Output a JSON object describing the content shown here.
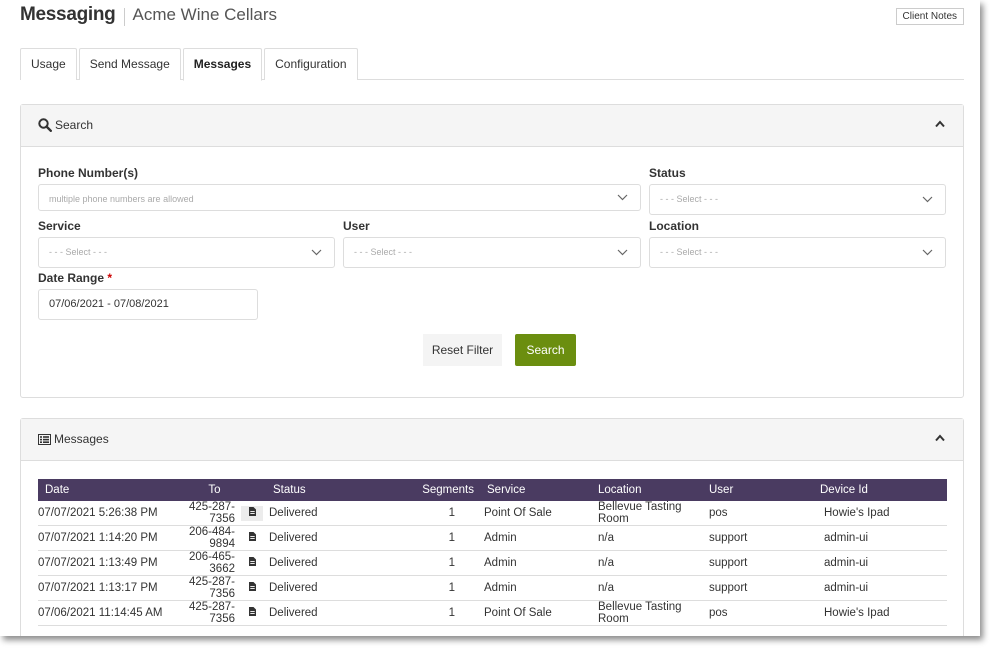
{
  "header": {
    "app_title": "Messaging",
    "client_name": "Acme Wine Cellars",
    "client_notes_label": "Client Notes"
  },
  "tabs": [
    {
      "label": "Usage",
      "active": false
    },
    {
      "label": "Send Message",
      "active": false
    },
    {
      "label": "Messages",
      "active": true
    },
    {
      "label": "Configuration",
      "active": false
    }
  ],
  "search_panel": {
    "title": "Search",
    "phone_numbers": {
      "label": "Phone Number(s)",
      "placeholder": "multiple phone numbers are allowed"
    },
    "status": {
      "label": "Status",
      "placeholder": "- - - Select - - -"
    },
    "service": {
      "label": "Service",
      "placeholder": "- - - Select - - -"
    },
    "user": {
      "label": "User",
      "placeholder": "- - - Select - - -"
    },
    "location": {
      "label": "Location",
      "placeholder": "- - - Select - - -"
    },
    "date_range": {
      "label": "Date Range",
      "required_mark": "*",
      "value": "07/06/2021 - 07/08/2021"
    },
    "reset_label": "Reset Filter",
    "search_label": "Search"
  },
  "messages_panel": {
    "title": "Messages",
    "columns": [
      "Date",
      "To",
      "Status",
      "Segments",
      "Service",
      "Location",
      "User",
      "Device Id"
    ],
    "rows": [
      {
        "date": "07/07/2021 5:26:38 PM",
        "to": "425-287-7356",
        "status": "Delivered",
        "segments": "1",
        "service": "Point Of Sale",
        "location": "Bellevue Tasting Room",
        "user": "pos",
        "device": "Howie's Ipad"
      },
      {
        "date": "07/07/2021 1:14:20 PM",
        "to": "206-484-9894",
        "status": "Delivered",
        "segments": "1",
        "service": "Admin",
        "location": "n/a",
        "user": "support",
        "device": "admin-ui"
      },
      {
        "date": "07/07/2021 1:13:49 PM",
        "to": "206-465-3662",
        "status": "Delivered",
        "segments": "1",
        "service": "Admin",
        "location": "n/a",
        "user": "support",
        "device": "admin-ui"
      },
      {
        "date": "07/07/2021 1:13:17 PM",
        "to": "425-287-7356",
        "status": "Delivered",
        "segments": "1",
        "service": "Admin",
        "location": "n/a",
        "user": "support",
        "device": "admin-ui"
      },
      {
        "date": "07/06/2021 11:14:45 AM",
        "to": "425-287-7356",
        "status": "Delivered",
        "segments": "1",
        "service": "Point Of Sale",
        "location": "Bellevue Tasting Room",
        "user": "pos",
        "device": "Howie's Ipad"
      }
    ]
  },
  "colors": {
    "table_header": "#4a3b61",
    "search_button": "#6b8e0f"
  },
  "icons": {
    "search": "search-icon",
    "messages": "list-icon",
    "collapse": "chevron-up-icon",
    "dropdown": "chevron-down-icon",
    "row_action": "document-icon"
  }
}
